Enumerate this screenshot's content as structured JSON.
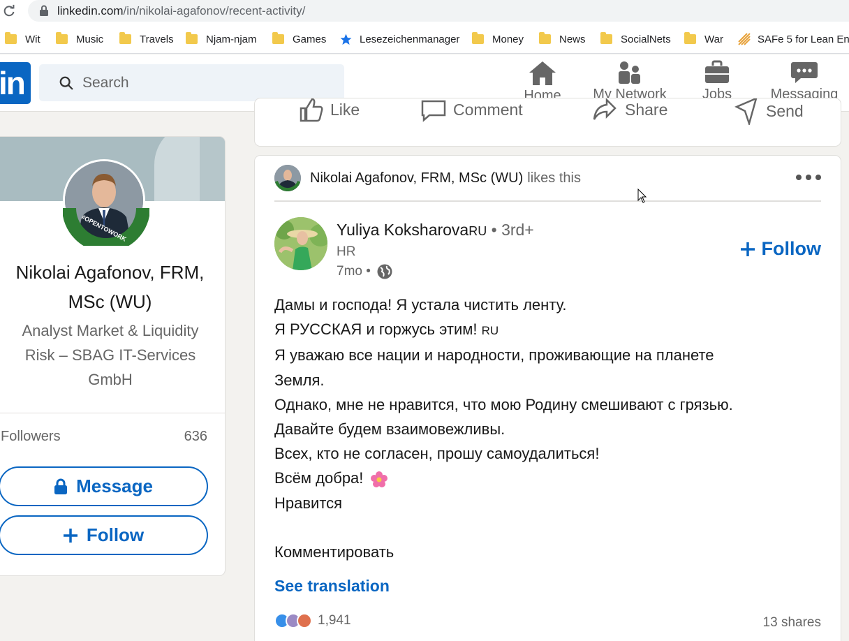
{
  "browser": {
    "url_domain": "linkedin.com",
    "url_path": "/in/nikolai-agafonov/recent-activity/",
    "bookmarks": [
      {
        "label": "Wit",
        "icon": "folder-icon"
      },
      {
        "label": "Music",
        "icon": "folder-icon"
      },
      {
        "label": "Travels",
        "icon": "folder-icon"
      },
      {
        "label": "Njam-njam",
        "icon": "folder-icon"
      },
      {
        "label": "Games",
        "icon": "folder-icon"
      },
      {
        "label": "Lesezeichenmanager",
        "icon": "star-icon"
      },
      {
        "label": "Money",
        "icon": "folder-icon"
      },
      {
        "label": "News",
        "icon": "folder-icon"
      },
      {
        "label": "SocialNets",
        "icon": "folder-icon"
      },
      {
        "label": "War",
        "icon": "folder-icon"
      },
      {
        "label": "SAFe 5 for Lean Ent...",
        "icon": "safe-icon"
      }
    ]
  },
  "header": {
    "logo": "in",
    "search_placeholder": "Search",
    "nav": {
      "home": "Home",
      "network": "My Network",
      "jobs": "Jobs",
      "messaging": "Messaging"
    }
  },
  "profile": {
    "name": "Nikolai Agafonov, FRM, MSc (WU)",
    "headline": "Analyst Market & Liquidity Risk – SBAG IT-Services GmbH",
    "open_to_work_badge": "#OPENTOWORK",
    "followers_label": "Followers",
    "followers_count": "636",
    "message_button": "Message",
    "follow_button": "Follow"
  },
  "previous_post_actions": {
    "like": "Like",
    "comment": "Comment",
    "share": "Share",
    "send": "Send"
  },
  "post": {
    "liker_name": "Nikolai Agafonov, FRM, MSc (WU)",
    "liker_action": "likes this",
    "author_name": "Yuliya Koksharova",
    "author_suffix": "RU",
    "author_degree": "• 3rd+",
    "author_title": "HR",
    "age": "7mo •",
    "follow_label": "Follow",
    "body_lines": [
      "Дамы и господа! Я устала чистить ленту.",
      "Я РУССКАЯ и горжусь этим!",
      "Я уважаю все нации и народности, проживающие на планете",
      "Земля.",
      "Однако, мне не нравится, что мою Родину смешивают с грязью.",
      "Давайте будем взаимовежливы.",
      "Всех, кто не согласен, прошу самоудалиться!",
      "Всём добра!",
      "Нравится",
      "",
      "Комментировать"
    ],
    "flag_suffix": "RU",
    "see_translation": "See translation",
    "reactions_count": "1,941",
    "shares": "13 shares"
  },
  "colors": {
    "linkedin_blue": "#0a66c2",
    "background": "#f3f2ef",
    "folder": "#f2c94c"
  }
}
